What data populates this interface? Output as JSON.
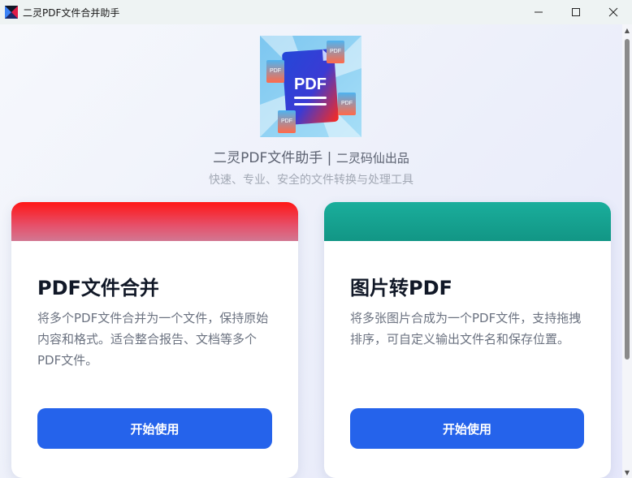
{
  "window": {
    "title": "二灵PDF文件合并助手",
    "minimize_glyph": "—",
    "maximize_glyph": "☐",
    "close_glyph": "✕"
  },
  "header": {
    "logo_text": "PDF",
    "mini_doc_label": "PDF",
    "app_name": "二灵PDF文件助手",
    "separator": " | ",
    "publisher": "二灵码仙出品",
    "tagline": "快速、专业、安全的文件转换与处理工具"
  },
  "cards": [
    {
      "title": "PDF文件合并",
      "description": "将多个PDF文件合并为一个文件，保持原始内容和格式。适合整合报告、文档等多个PDF文件。",
      "button_label": "开始使用",
      "accent": "#ff1616"
    },
    {
      "title": "图片转PDF",
      "description": "将多张图片合成为一个PDF文件，支持拖拽排序，可自定义输出文件名和保存位置。",
      "button_label": "开始使用",
      "accent": "#1aae9c"
    }
  ],
  "colors": {
    "primary_button": "#2563eb"
  }
}
